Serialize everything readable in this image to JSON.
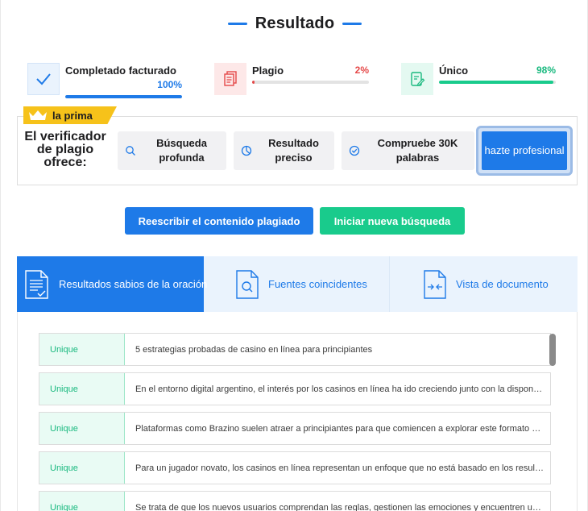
{
  "title": "Resultado",
  "stats": {
    "completed": {
      "label": "Completado facturado",
      "value": "100%",
      "progress": 1.0,
      "color": "#1e7ae8"
    },
    "plagiarism": {
      "label": "Plagio",
      "value": "2%",
      "progress": 0.02,
      "color": "#e54848"
    },
    "unique": {
      "label": "Único",
      "value": "98%",
      "progress": 0.98,
      "color": "#19cb8c"
    }
  },
  "premium": {
    "badge": "la prima",
    "lead": "El verificador de plagio ofrece:",
    "features": [
      {
        "icon": "search-icon",
        "label": "Búsqueda profunda"
      },
      {
        "icon": "pie-chart-icon",
        "label": "Resultado preciso"
      },
      {
        "icon": "check-circle-icon",
        "label": "Compruebe 30K palabras"
      }
    ],
    "pro_button": "hazte profesional"
  },
  "actions": {
    "rewrite": "Reescribir el contenido plagiado",
    "new_search": "Iniciar nueva búsqueda"
  },
  "tabs": [
    {
      "icon": "document-lines-icon",
      "label": "Resultados sabios de la oración",
      "active": true
    },
    {
      "icon": "document-search-icon",
      "label": "Fuentes coincidentes",
      "active": false
    },
    {
      "icon": "document-compare-icon",
      "label": "Vista de documento",
      "active": false
    }
  ],
  "results": [
    {
      "status": "Unique",
      "text": "5 estrategias probadas de casino en línea para principiantes"
    },
    {
      "status": "Unique",
      "text": "En el entorno digital argentino, el interés por los casinos en línea ha ido creciendo junto con la disponibili..."
    },
    {
      "status": "Unique",
      "text": "Plataformas como Brazino suelen atraer a principiantes para que comiencen a explorar este formato de e..."
    },
    {
      "status": "Unique",
      "text": "Para un jugador novato, los casinos en línea representan un enfoque que no está basado en los resultado..."
    },
    {
      "status": "Unique",
      "text": "Se trata de que los nuevos usuarios comprendan las reglas, gestionen las emociones y encuentren un rit..."
    }
  ]
}
